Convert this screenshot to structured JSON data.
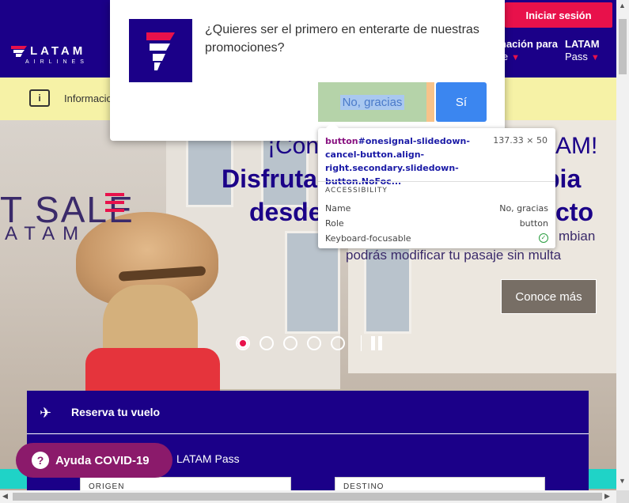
{
  "header": {
    "login_label": "Iniciar sesión",
    "logo_word": "LATAM",
    "logo_sub": "AIRLINES",
    "nav": {
      "item1_line1": "nación para",
      "item1_line2": "je",
      "item2_line1": "LATAM",
      "item2_line2": "Pass"
    }
  },
  "infobar": {
    "icon": "info-icon",
    "text": "Informacio"
  },
  "hero": {
    "sale_title": "T SALE",
    "sale_sub": "ATAM",
    "line1": "¡Con",
    "line1_tail": "AM!",
    "line2": "Disfruta",
    "line2_tail": "bia",
    "line3": "desde",
    "line3_tail": "cto",
    "text1": "mbian",
    "text2": "podrás modificar tu pasaje sin multa",
    "cta_label": "Conoce más",
    "dot_count": 5,
    "active_dot": 0
  },
  "booking": {
    "title": "Reserva tu vuelo",
    "pass_label": "LATAM Pass",
    "origin_label": "ORIGEN",
    "destination_label": "DESTINO"
  },
  "covid": {
    "label": "Ayuda COVID-19",
    "icon": "?"
  },
  "modal": {
    "message": "¿Quieres ser el primero en enterarte de nuestras promociones?",
    "no_label": "No, gracias",
    "yes_label": "Sí"
  },
  "devtools_tooltip": {
    "selector_tag": "button",
    "selector_rest": "#onesignal-slidedown-cancel-button.align-right.secondary.slidedown-button.NoFoc...",
    "size": "137.33 × 50",
    "section": "ACCESSIBILITY",
    "rows": [
      {
        "key": "Name",
        "value": "No, gracias"
      },
      {
        "key": "Role",
        "value": "button"
      },
      {
        "key": "Keyboard-focusable",
        "value": ""
      }
    ]
  },
  "colors": {
    "brand": "#1b0088",
    "accent": "#e8114b",
    "covid": "#8b1a6b",
    "yes_button": "#3b86f0"
  }
}
